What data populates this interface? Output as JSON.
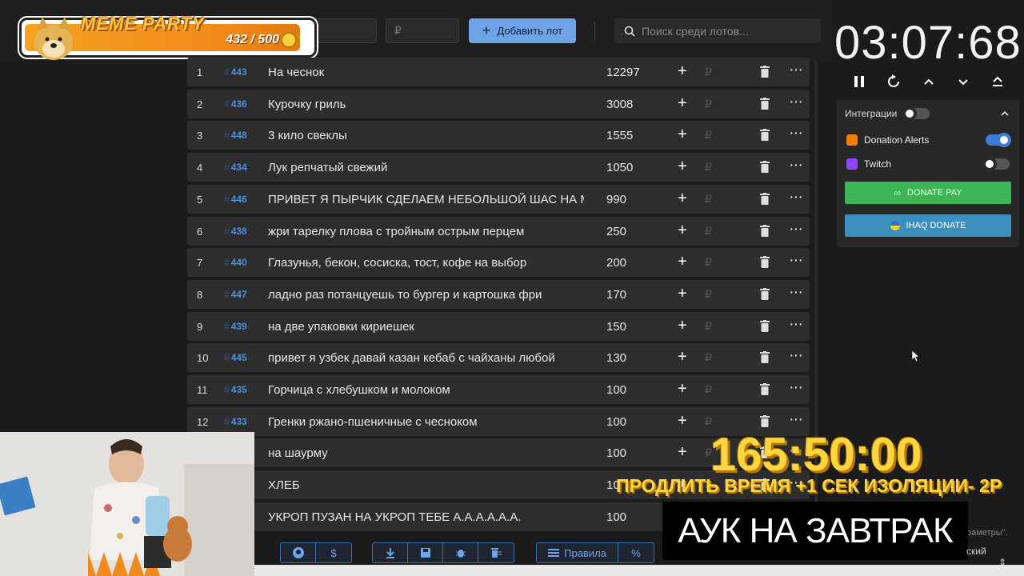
{
  "topbar": {
    "amount_placeholder": "₽",
    "add_button": "Добавить лот",
    "search_placeholder": "Поиск среди лотов..."
  },
  "banner": {
    "title": "MEME PARTY",
    "score": "432 / 500"
  },
  "timer": "03:07:68",
  "lots": [
    {
      "num": "1",
      "id": "443",
      "name": "На чеснок",
      "amount": "12297"
    },
    {
      "num": "2",
      "id": "436",
      "name": "Курочку гриль",
      "amount": "3008"
    },
    {
      "num": "3",
      "id": "448",
      "name": "3 кило свеклы",
      "amount": "1555"
    },
    {
      "num": "4",
      "id": "434",
      "name": "Лук репчатый свежий",
      "amount": "1050"
    },
    {
      "num": "5",
      "id": "446",
      "name": "ПРИВЕТ Я ПЫРЧИК СДЕЛАЕМ НЕБОЛЬШОЙ ШАС НА МЕ",
      "amount": "990"
    },
    {
      "num": "6",
      "id": "438",
      "name": "жри тарелку плова с тройным острым перцем",
      "amount": "250"
    },
    {
      "num": "7",
      "id": "440",
      "name": " Глазунья, бекон, сосиска, тост, кофе на выбор",
      "amount": "200"
    },
    {
      "num": "8",
      "id": "447",
      "name": "ладно раз потанцуешь то бургер и картошка фри",
      "amount": "170"
    },
    {
      "num": "9",
      "id": "439",
      "name": "на две упаковки кириешек",
      "amount": "150"
    },
    {
      "num": "10",
      "id": "445",
      "name": "привет я узбек давай казан кебаб с чайханы любой",
      "amount": "130"
    },
    {
      "num": "11",
      "id": "435",
      "name": "Горчица с хлебушком и молоком",
      "amount": "100"
    },
    {
      "num": "12",
      "id": "433",
      "name": "Гренки ржано-пшеничные с чесноком",
      "amount": "100"
    },
    {
      "num": "",
      "id": "",
      "name": " на шаурму",
      "amount": "100"
    },
    {
      "num": "",
      "id": "",
      "name": "ХЛЕБ",
      "amount": "10"
    },
    {
      "num": "",
      "id": "",
      "name": " УКРОП ПУЗАН НА УКРОП ТЕБЕ А.А.А.А.А.А.",
      "amount": "100"
    }
  ],
  "integrations": {
    "title": "Интеграции",
    "services": [
      {
        "name": "Donation Alerts",
        "enabled": true,
        "color": "#f57d07"
      },
      {
        "name": "Twitch",
        "enabled": false,
        "color": "#9146ff"
      }
    ],
    "donate_pay": "DONATE PAY",
    "ihaq_donate": "IHAQ DONATE"
  },
  "overlay": {
    "big_timer": "165:50:00",
    "extend": "ПРОДЛИТЬ ВРЕМЯ +1 СЕК ИЗОЛЯЦИИ- 2Р",
    "auk": "АУК НА ЗАВТРАК"
  },
  "toolbar": {
    "rules": "Правила",
    "percent": "%",
    "currency": "$"
  },
  "footer": {
    "params": "раметры\".",
    "language": "ский"
  }
}
